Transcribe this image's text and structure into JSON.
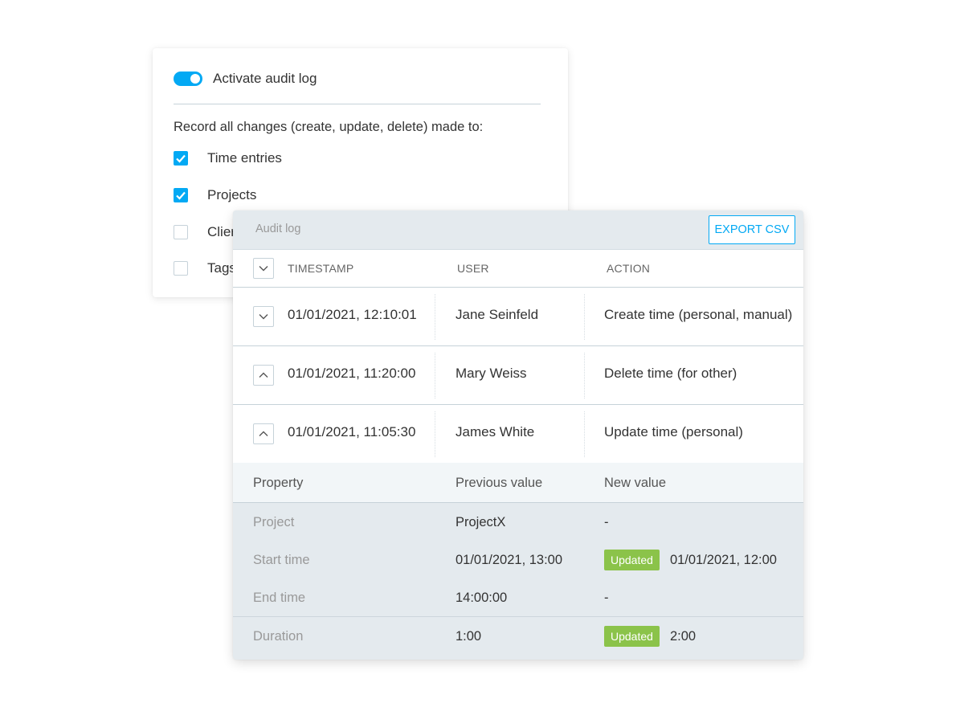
{
  "settings": {
    "toggle_label": "Activate audit log",
    "toggle_on": true,
    "record_text": "Record all changes (create, update, delete) made to:",
    "items": [
      {
        "label": "Time entries",
        "checked": true
      },
      {
        "label": "Projects",
        "checked": true
      },
      {
        "label": "Clients",
        "checked": false
      },
      {
        "label": "Tags",
        "checked": false
      }
    ],
    "visible_labels": [
      "Time entries",
      "Projects",
      "Clier",
      "Tags"
    ]
  },
  "audit": {
    "title": "Audit log",
    "export_label": "EXPORT CSV",
    "columns": {
      "timestamp": "TIMESTAMP",
      "user": "USER",
      "action": "ACTION"
    },
    "rows": [
      {
        "timestamp": "01/01/2021, 12:10:01",
        "user": "Jane Seinfeld",
        "action": "Create time (personal, manual)",
        "expanded": false
      },
      {
        "timestamp": "01/01/2021, 11:20:00",
        "user": "Mary Weiss",
        "action": "Delete time (for other)",
        "expanded": true
      },
      {
        "timestamp": "01/01/2021, 11:05:30",
        "user": "James White",
        "action": "Update time (personal)",
        "expanded": true
      }
    ],
    "detail": {
      "columns": {
        "property": "Property",
        "previous": "Previous value",
        "new": "New value"
      },
      "rows": [
        {
          "property": "Project",
          "previous": "ProjectX",
          "badge": "",
          "new": "-"
        },
        {
          "property": "Start time",
          "previous": "01/01/2021, 13:00",
          "badge": "Updated",
          "new": "01/01/2021, 12:00"
        },
        {
          "property": "End time",
          "previous": "14:00:00",
          "badge": "",
          "new": "-"
        },
        {
          "property": "Duration",
          "previous": "1:00",
          "badge": "Updated",
          "new": "2:00"
        }
      ]
    }
  },
  "colors": {
    "accent": "#03a9f4",
    "badge": "#8bc34a",
    "panel": "#e4eaee"
  }
}
